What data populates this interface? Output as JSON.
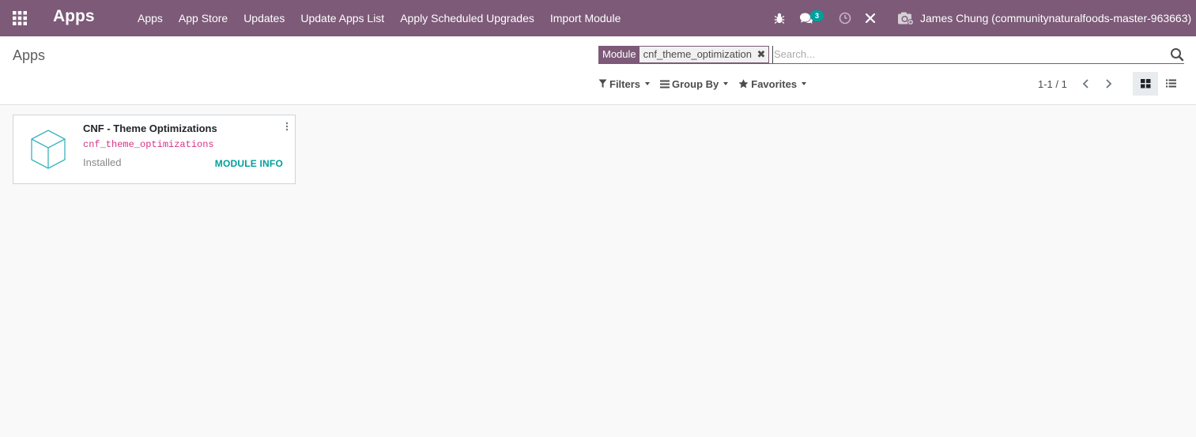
{
  "navbar": {
    "app_title": "Apps",
    "menu": [
      "Apps",
      "App Store",
      "Updates",
      "Update Apps List",
      "Apply Scheduled Upgrades",
      "Import Module"
    ],
    "messages_badge": "3",
    "user_name": "James Chung (communitynaturalfoods-master-963663)"
  },
  "control_panel": {
    "breadcrumb": "Apps",
    "search": {
      "facet_label": "Module",
      "facet_value": "cnf_theme_optimization",
      "facet_remove_glyph": "✖",
      "placeholder": "Search..."
    },
    "filters_label": "Filters",
    "group_by_label": "Group By",
    "favorites_label": "Favorites",
    "pager": "1-1 / 1"
  },
  "module_card": {
    "title": "CNF - Theme Optimizations",
    "technical_name": "cnf_theme_optimizations",
    "state": "Installed",
    "info_button": "MODULE INFO"
  },
  "colors": {
    "navbar": "#7c5a78",
    "accent": "#00a09d",
    "technical_name": "#d63384"
  }
}
